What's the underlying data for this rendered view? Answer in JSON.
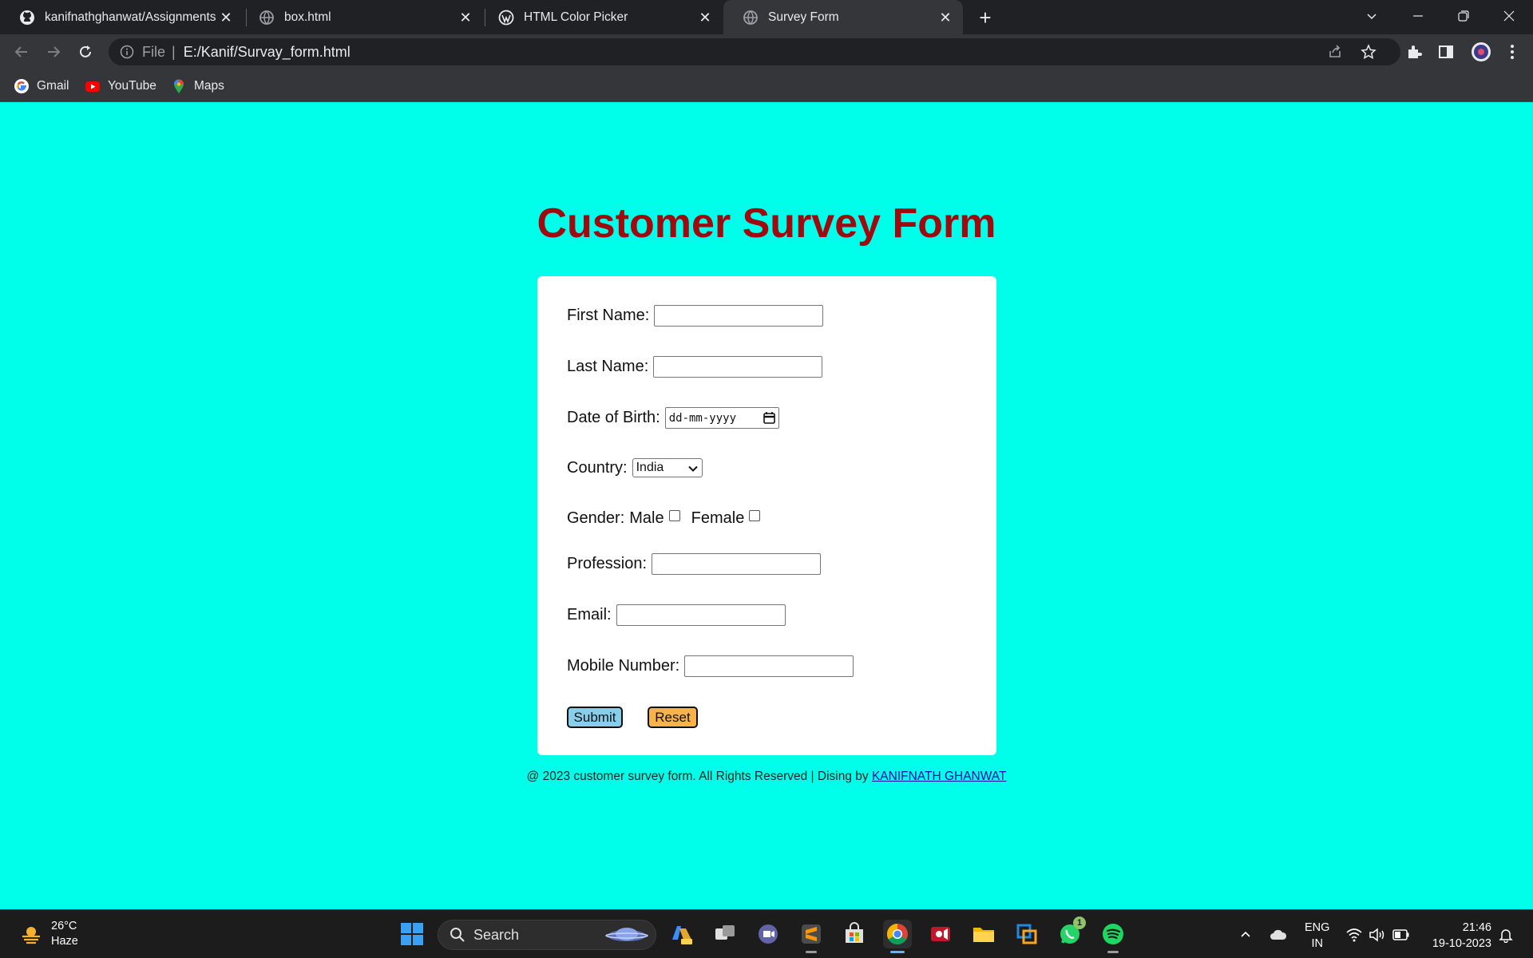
{
  "browser": {
    "tabs": [
      {
        "title": "kanifnathghanwat/Assignments",
        "icon": "github-icon"
      },
      {
        "title": "box.html",
        "icon": "globe-icon"
      },
      {
        "title": "HTML Color Picker",
        "icon": "wordpress-icon"
      },
      {
        "title": "Survey Form",
        "icon": "globe-icon",
        "active": true
      }
    ],
    "address_scheme": "File",
    "address_url": "E:/Kanif/Survay_form.html",
    "bookmarks": [
      {
        "label": "Gmail",
        "icon": "google-icon"
      },
      {
        "label": "YouTube",
        "icon": "youtube-icon"
      },
      {
        "label": "Maps",
        "icon": "maps-icon"
      }
    ]
  },
  "page": {
    "background_color": "#00ffea",
    "title": "Customer Survey Form",
    "title_color": "#a0090e",
    "form": {
      "first_name_label": "First Name:",
      "last_name_label": "Last Name:",
      "dob_label": "Date of Birth:",
      "dob_placeholder": "dd-mm-yyyy",
      "country_label": "Country:",
      "country_selected": "India",
      "gender_label": "Gender:",
      "gender_male": "Male",
      "gender_female": "Female",
      "profession_label": "Profession:",
      "email_label": "Email:",
      "mobile_label": "Mobile Number:",
      "submit_label": "Submit",
      "submit_color": "#87ceeb",
      "reset_label": "Reset",
      "reset_color": "#f7b24a"
    },
    "footer_text": "@ 2023 customer survey form. All Rights Reserved | Dising by",
    "footer_link": "KANIFNATH GHANWAT"
  },
  "taskbar": {
    "weather_temp": "26°C",
    "weather_desc": "Haze",
    "search_label": "Search",
    "lang_line1": "ENG",
    "lang_line2": "IN",
    "time": "21:46",
    "date": "19-10-2023",
    "whatsapp_badge": "1"
  }
}
